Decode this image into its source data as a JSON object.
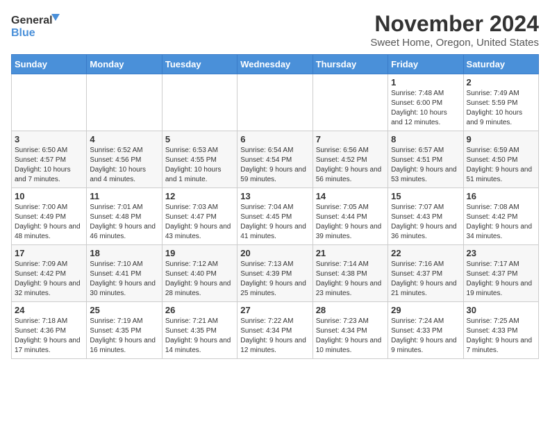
{
  "logo": {
    "line1": "General",
    "line2": "Blue"
  },
  "title": "November 2024",
  "location": "Sweet Home, Oregon, United States",
  "days_of_week": [
    "Sunday",
    "Monday",
    "Tuesday",
    "Wednesday",
    "Thursday",
    "Friday",
    "Saturday"
  ],
  "weeks": [
    [
      {
        "day": "",
        "info": ""
      },
      {
        "day": "",
        "info": ""
      },
      {
        "day": "",
        "info": ""
      },
      {
        "day": "",
        "info": ""
      },
      {
        "day": "",
        "info": ""
      },
      {
        "day": "1",
        "info": "Sunrise: 7:48 AM\nSunset: 6:00 PM\nDaylight: 10 hours and 12 minutes."
      },
      {
        "day": "2",
        "info": "Sunrise: 7:49 AM\nSunset: 5:59 PM\nDaylight: 10 hours and 9 minutes."
      }
    ],
    [
      {
        "day": "3",
        "info": "Sunrise: 6:50 AM\nSunset: 4:57 PM\nDaylight: 10 hours and 7 minutes."
      },
      {
        "day": "4",
        "info": "Sunrise: 6:52 AM\nSunset: 4:56 PM\nDaylight: 10 hours and 4 minutes."
      },
      {
        "day": "5",
        "info": "Sunrise: 6:53 AM\nSunset: 4:55 PM\nDaylight: 10 hours and 1 minute."
      },
      {
        "day": "6",
        "info": "Sunrise: 6:54 AM\nSunset: 4:54 PM\nDaylight: 9 hours and 59 minutes."
      },
      {
        "day": "7",
        "info": "Sunrise: 6:56 AM\nSunset: 4:52 PM\nDaylight: 9 hours and 56 minutes."
      },
      {
        "day": "8",
        "info": "Sunrise: 6:57 AM\nSunset: 4:51 PM\nDaylight: 9 hours and 53 minutes."
      },
      {
        "day": "9",
        "info": "Sunrise: 6:59 AM\nSunset: 4:50 PM\nDaylight: 9 hours and 51 minutes."
      }
    ],
    [
      {
        "day": "10",
        "info": "Sunrise: 7:00 AM\nSunset: 4:49 PM\nDaylight: 9 hours and 48 minutes."
      },
      {
        "day": "11",
        "info": "Sunrise: 7:01 AM\nSunset: 4:48 PM\nDaylight: 9 hours and 46 minutes."
      },
      {
        "day": "12",
        "info": "Sunrise: 7:03 AM\nSunset: 4:47 PM\nDaylight: 9 hours and 43 minutes."
      },
      {
        "day": "13",
        "info": "Sunrise: 7:04 AM\nSunset: 4:45 PM\nDaylight: 9 hours and 41 minutes."
      },
      {
        "day": "14",
        "info": "Sunrise: 7:05 AM\nSunset: 4:44 PM\nDaylight: 9 hours and 39 minutes."
      },
      {
        "day": "15",
        "info": "Sunrise: 7:07 AM\nSunset: 4:43 PM\nDaylight: 9 hours and 36 minutes."
      },
      {
        "day": "16",
        "info": "Sunrise: 7:08 AM\nSunset: 4:42 PM\nDaylight: 9 hours and 34 minutes."
      }
    ],
    [
      {
        "day": "17",
        "info": "Sunrise: 7:09 AM\nSunset: 4:42 PM\nDaylight: 9 hours and 32 minutes."
      },
      {
        "day": "18",
        "info": "Sunrise: 7:10 AM\nSunset: 4:41 PM\nDaylight: 9 hours and 30 minutes."
      },
      {
        "day": "19",
        "info": "Sunrise: 7:12 AM\nSunset: 4:40 PM\nDaylight: 9 hours and 28 minutes."
      },
      {
        "day": "20",
        "info": "Sunrise: 7:13 AM\nSunset: 4:39 PM\nDaylight: 9 hours and 25 minutes."
      },
      {
        "day": "21",
        "info": "Sunrise: 7:14 AM\nSunset: 4:38 PM\nDaylight: 9 hours and 23 minutes."
      },
      {
        "day": "22",
        "info": "Sunrise: 7:16 AM\nSunset: 4:37 PM\nDaylight: 9 hours and 21 minutes."
      },
      {
        "day": "23",
        "info": "Sunrise: 7:17 AM\nSunset: 4:37 PM\nDaylight: 9 hours and 19 minutes."
      }
    ],
    [
      {
        "day": "24",
        "info": "Sunrise: 7:18 AM\nSunset: 4:36 PM\nDaylight: 9 hours and 17 minutes."
      },
      {
        "day": "25",
        "info": "Sunrise: 7:19 AM\nSunset: 4:35 PM\nDaylight: 9 hours and 16 minutes."
      },
      {
        "day": "26",
        "info": "Sunrise: 7:21 AM\nSunset: 4:35 PM\nDaylight: 9 hours and 14 minutes."
      },
      {
        "day": "27",
        "info": "Sunrise: 7:22 AM\nSunset: 4:34 PM\nDaylight: 9 hours and 12 minutes."
      },
      {
        "day": "28",
        "info": "Sunrise: 7:23 AM\nSunset: 4:34 PM\nDaylight: 9 hours and 10 minutes."
      },
      {
        "day": "29",
        "info": "Sunrise: 7:24 AM\nSunset: 4:33 PM\nDaylight: 9 hours and 9 minutes."
      },
      {
        "day": "30",
        "info": "Sunrise: 7:25 AM\nSunset: 4:33 PM\nDaylight: 9 hours and 7 minutes."
      }
    ]
  ]
}
